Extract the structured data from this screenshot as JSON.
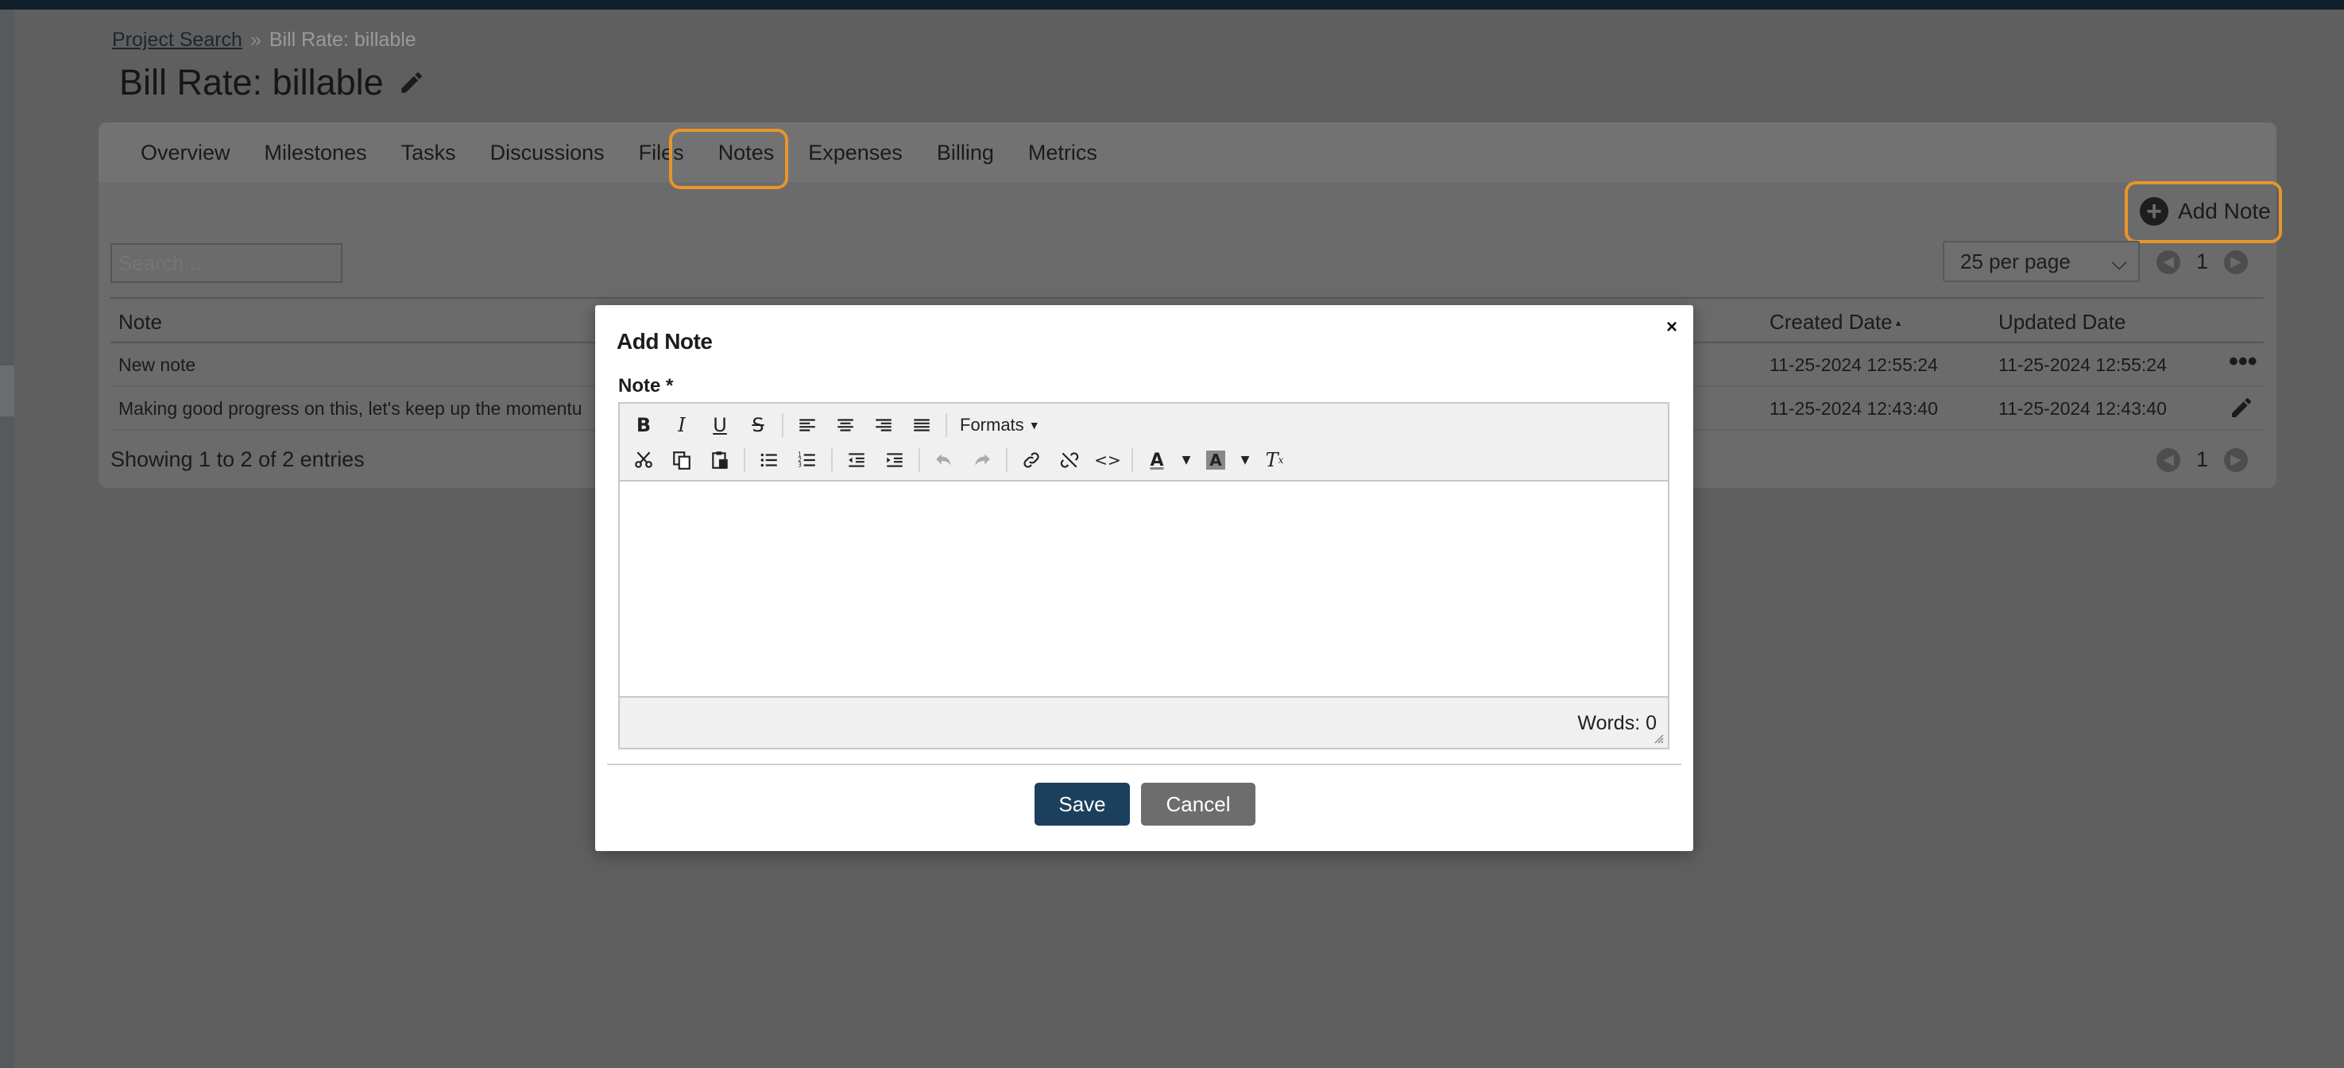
{
  "breadcrumb": {
    "link": "Project Search",
    "separator": "»",
    "current": "Bill Rate: billable"
  },
  "page_title": "Bill Rate: billable",
  "tabs": [
    {
      "label": "Overview"
    },
    {
      "label": "Milestones"
    },
    {
      "label": "Tasks"
    },
    {
      "label": "Discussions"
    },
    {
      "label": "Files"
    },
    {
      "label": "Notes",
      "active": true
    },
    {
      "label": "Expenses"
    },
    {
      "label": "Billing"
    },
    {
      "label": "Metrics"
    }
  ],
  "add_note_label": "Add Note",
  "search": {
    "placeholder": "Search..."
  },
  "per_page": "25 per page",
  "pager": {
    "page": "1"
  },
  "table": {
    "headers": {
      "note": "Note",
      "created": "Created Date",
      "updated": "Updated Date",
      "sort_indicator": "▲"
    },
    "rows": [
      {
        "note": "New note",
        "created": "11-25-2024 12:55:24",
        "updated": "11-25-2024 12:55:24",
        "action": "more-icon"
      },
      {
        "note": "Making good progress on this, let's keep up the momentu",
        "created": "11-25-2024 12:43:40",
        "updated": "11-25-2024 12:43:40",
        "action": "pencil-icon"
      }
    ]
  },
  "showing": "Showing 1 to 2 of 2 entries",
  "modal": {
    "title": "Add Note",
    "close": "×",
    "field_label": "Note *",
    "formats_label": "Formats",
    "word_count": "Words: 0",
    "save_label": "Save",
    "cancel_label": "Cancel"
  },
  "colors": {
    "highlight_ring": "#e8952a",
    "save_button": "#1d3f5e",
    "cancel_button": "#6d6d6d",
    "topbar": "#0f1f2c"
  }
}
